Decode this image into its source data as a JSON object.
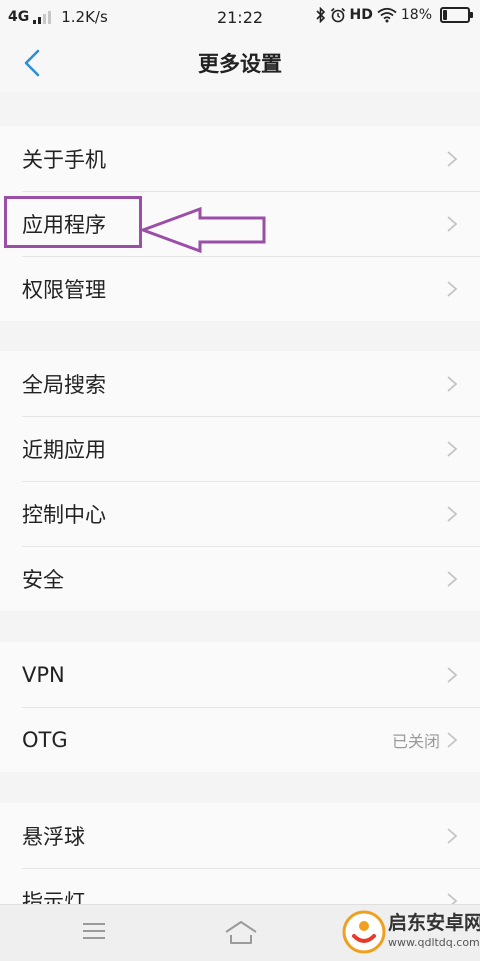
{
  "status_bar": {
    "network": "4G",
    "speed": "1.2K/s",
    "time": "21:22",
    "hd": "HD",
    "battery_percent": "18%",
    "battery_level": 0.18
  },
  "header": {
    "title": "更多设置"
  },
  "sections": [
    {
      "items": [
        {
          "label": "关于手机"
        },
        {
          "label": "应用程序"
        },
        {
          "label": "权限管理"
        }
      ]
    },
    {
      "items": [
        {
          "label": "全局搜索"
        },
        {
          "label": "近期应用"
        },
        {
          "label": "控制中心"
        },
        {
          "label": "安全"
        }
      ]
    },
    {
      "items": [
        {
          "label": "VPN"
        },
        {
          "label": "OTG",
          "value": "已关闭"
        }
      ]
    },
    {
      "items": [
        {
          "label": "悬浮球"
        },
        {
          "label": "指示灯"
        }
      ]
    }
  ],
  "watermark": {
    "name": "启东安卓网",
    "url": "www.qdltdq.com"
  },
  "colors": {
    "accent": "#2d8fd6",
    "highlight": "#9b4ea6",
    "background": "#f4f4f4",
    "row_background": "#fafafa"
  }
}
